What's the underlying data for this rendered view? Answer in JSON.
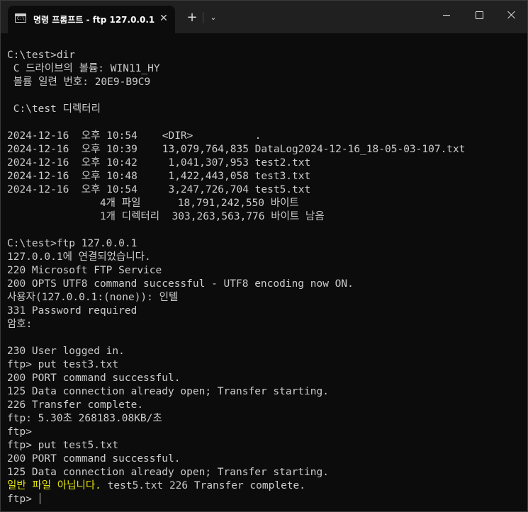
{
  "window": {
    "tab_title": "명령 프롬프트 - ftp  127.0.0.1",
    "tab_icon": "cmd-icon",
    "tab_icon_text": "C:\\",
    "close_tab_glyph": "✕",
    "new_tab_glyph": "+",
    "dropdown_glyph": "⌄"
  },
  "terminal": {
    "lines": [
      "",
      "C:\\test>dir",
      " C 드라이브의 볼륨: WIN11_HY",
      " 볼륨 일련 번호: 20E9-B9C9",
      "",
      " C:\\test 디렉터리",
      "",
      "2024-12-16  오후 10:54    <DIR>          .",
      "2024-12-16  오후 10:39    13,079,764,835 DataLog2024-12-16_18-05-03-107.txt",
      "2024-12-16  오후 10:42     1,041,307,953 test2.txt",
      "2024-12-16  오후 10:48     1,422,443,058 test3.txt",
      "2024-12-16  오후 10:54     3,247,726,704 test5.txt",
      "               4개 파일      18,791,242,550 바이트",
      "               1개 디렉터리  303,263,563,776 바이트 남음",
      "",
      "C:\\test>ftp 127.0.0.1",
      "127.0.0.1에 연결되었습니다.",
      "220 Microsoft FTP Service",
      "200 OPTS UTF8 command successful - UTF8 encoding now ON.",
      "사용자(127.0.0.1:(none)): 인텔",
      "331 Password required",
      "암호:",
      "",
      "230 User logged in.",
      "ftp> put test3.txt",
      "200 PORT command successful.",
      "125 Data connection already open; Transfer starting.",
      "226 Transfer complete.",
      "ftp: 5.30초 268183.08KB/초",
      "ftp>",
      "ftp> put test5.txt",
      "200 PORT command successful.",
      "125 Data connection already open; Transfer starting."
    ],
    "error_line": {
      "highlight": "일반 파일 아닙니다.",
      "rest": " test5.txt 226 Transfer complete."
    },
    "prompt": "ftp> ",
    "colors": {
      "background": "#0c0c0c",
      "text": "#cccccc",
      "highlight": "#e5e510"
    }
  }
}
